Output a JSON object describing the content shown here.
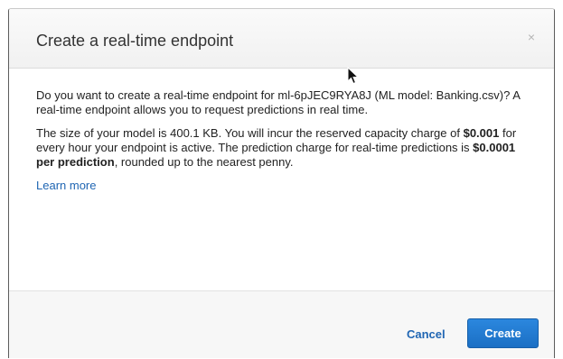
{
  "dialog": {
    "title": "Create a real-time endpoint",
    "close_icon": "close-icon",
    "close_glyph": "×"
  },
  "body": {
    "paragraph1": "Do you want to create a real-time endpoint for ml-6pJEC9RYA8J (ML model: Banking.csv)? A real-time endpoint allows you to request predictions in real time.",
    "paragraph2_part1": "The size of your model is 400.1 KB. You will incur the reserved capacity charge of ",
    "reserved_charge": "$0.001",
    "paragraph2_part2": " for every hour your endpoint is active. The prediction charge for real-time predictions is ",
    "prediction_charge": "$0.0001 per prediction",
    "paragraph2_part3": ", rounded up to the nearest penny.",
    "learn_more": "Learn more"
  },
  "footer": {
    "cancel_label": "Cancel",
    "create_label": "Create"
  },
  "colors": {
    "accent": "#2066b3",
    "primary_button": "#1b6fc4",
    "header_bg": "#f1f1f1",
    "footer_bg": "#f7f7f7"
  }
}
